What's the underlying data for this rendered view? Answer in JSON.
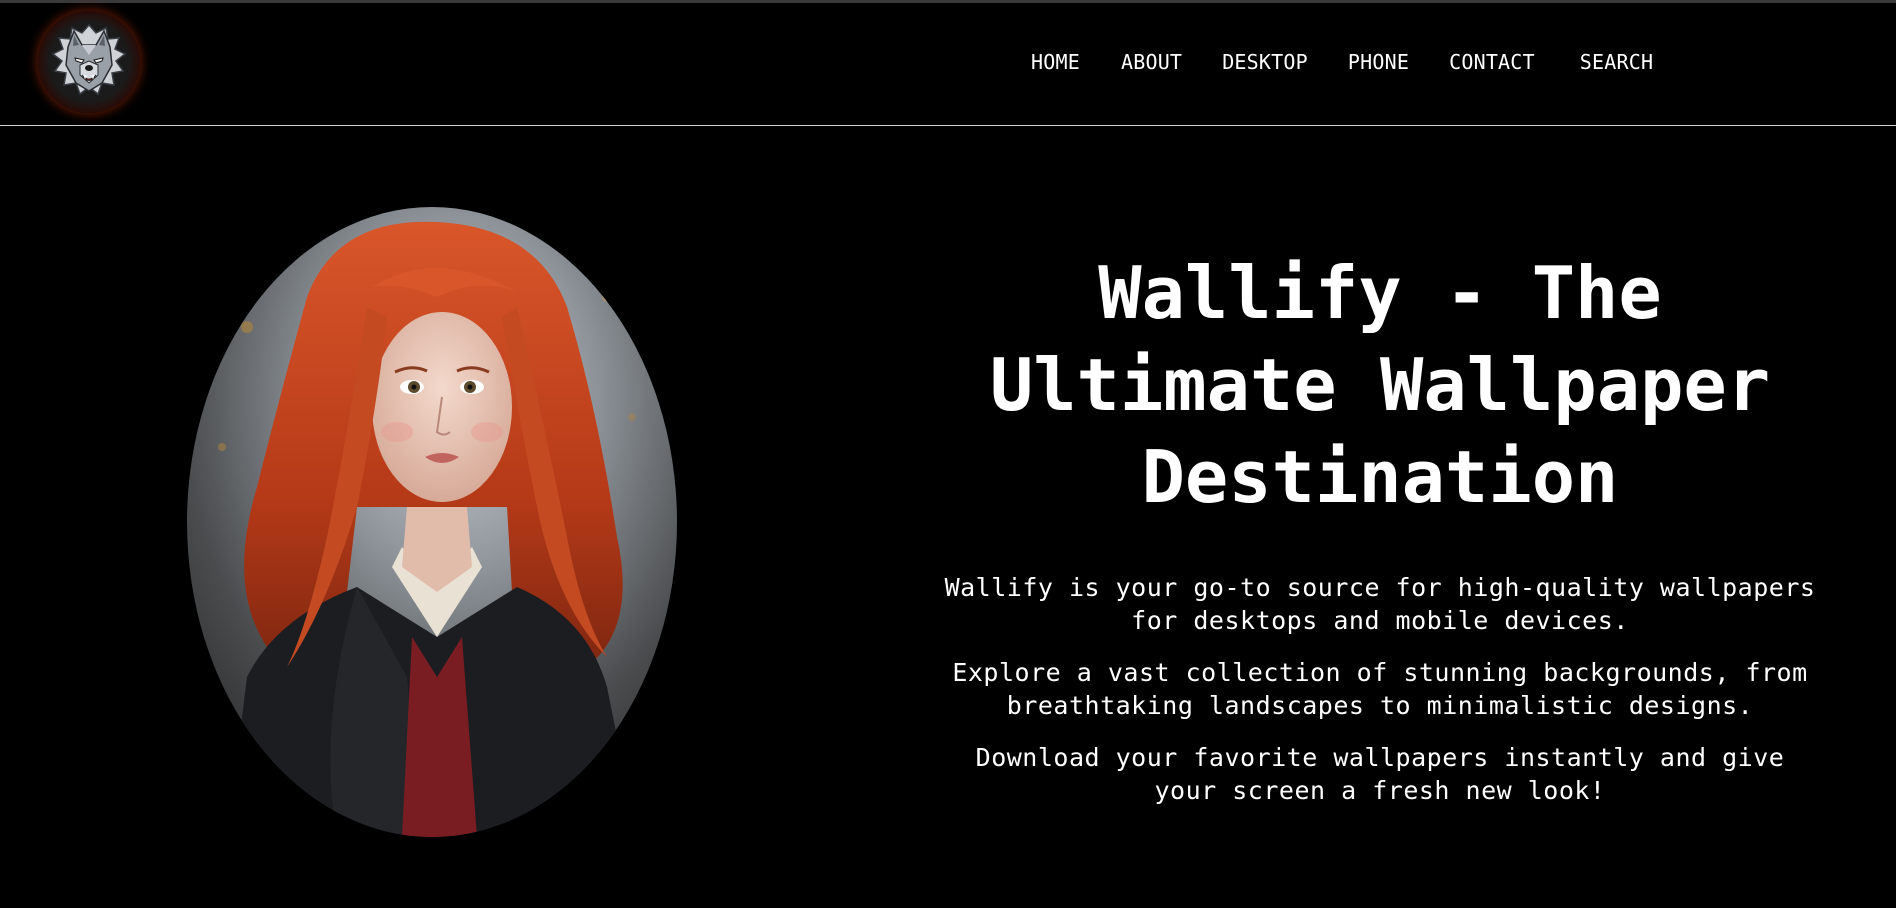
{
  "header": {
    "logo_icon": "wolf-head-icon",
    "nav": [
      {
        "label": "HOME"
      },
      {
        "label": "ABOUT"
      },
      {
        "label": "DESKTOP"
      },
      {
        "label": "PHONE"
      },
      {
        "label": "CONTACT"
      },
      {
        "label": "SEARCH"
      }
    ]
  },
  "hero": {
    "image": "red-haired-girl-portrait",
    "title": "Wallify - The Ultimate Wallpaper Destination",
    "paragraphs": [
      "Wallify is your go-to source for high-quality wallpapers for desktops and mobile devices.",
      "Explore a vast collection of stunning backgrounds, from breathtaking landscapes to minimalistic designs.",
      "Download your favorite wallpapers instantly and give your screen a fresh new look!"
    ]
  },
  "colors": {
    "background": "#000000",
    "text": "#ffffff",
    "header_border": "#cfcfcf",
    "logo_glow": "#aa2d0a"
  }
}
